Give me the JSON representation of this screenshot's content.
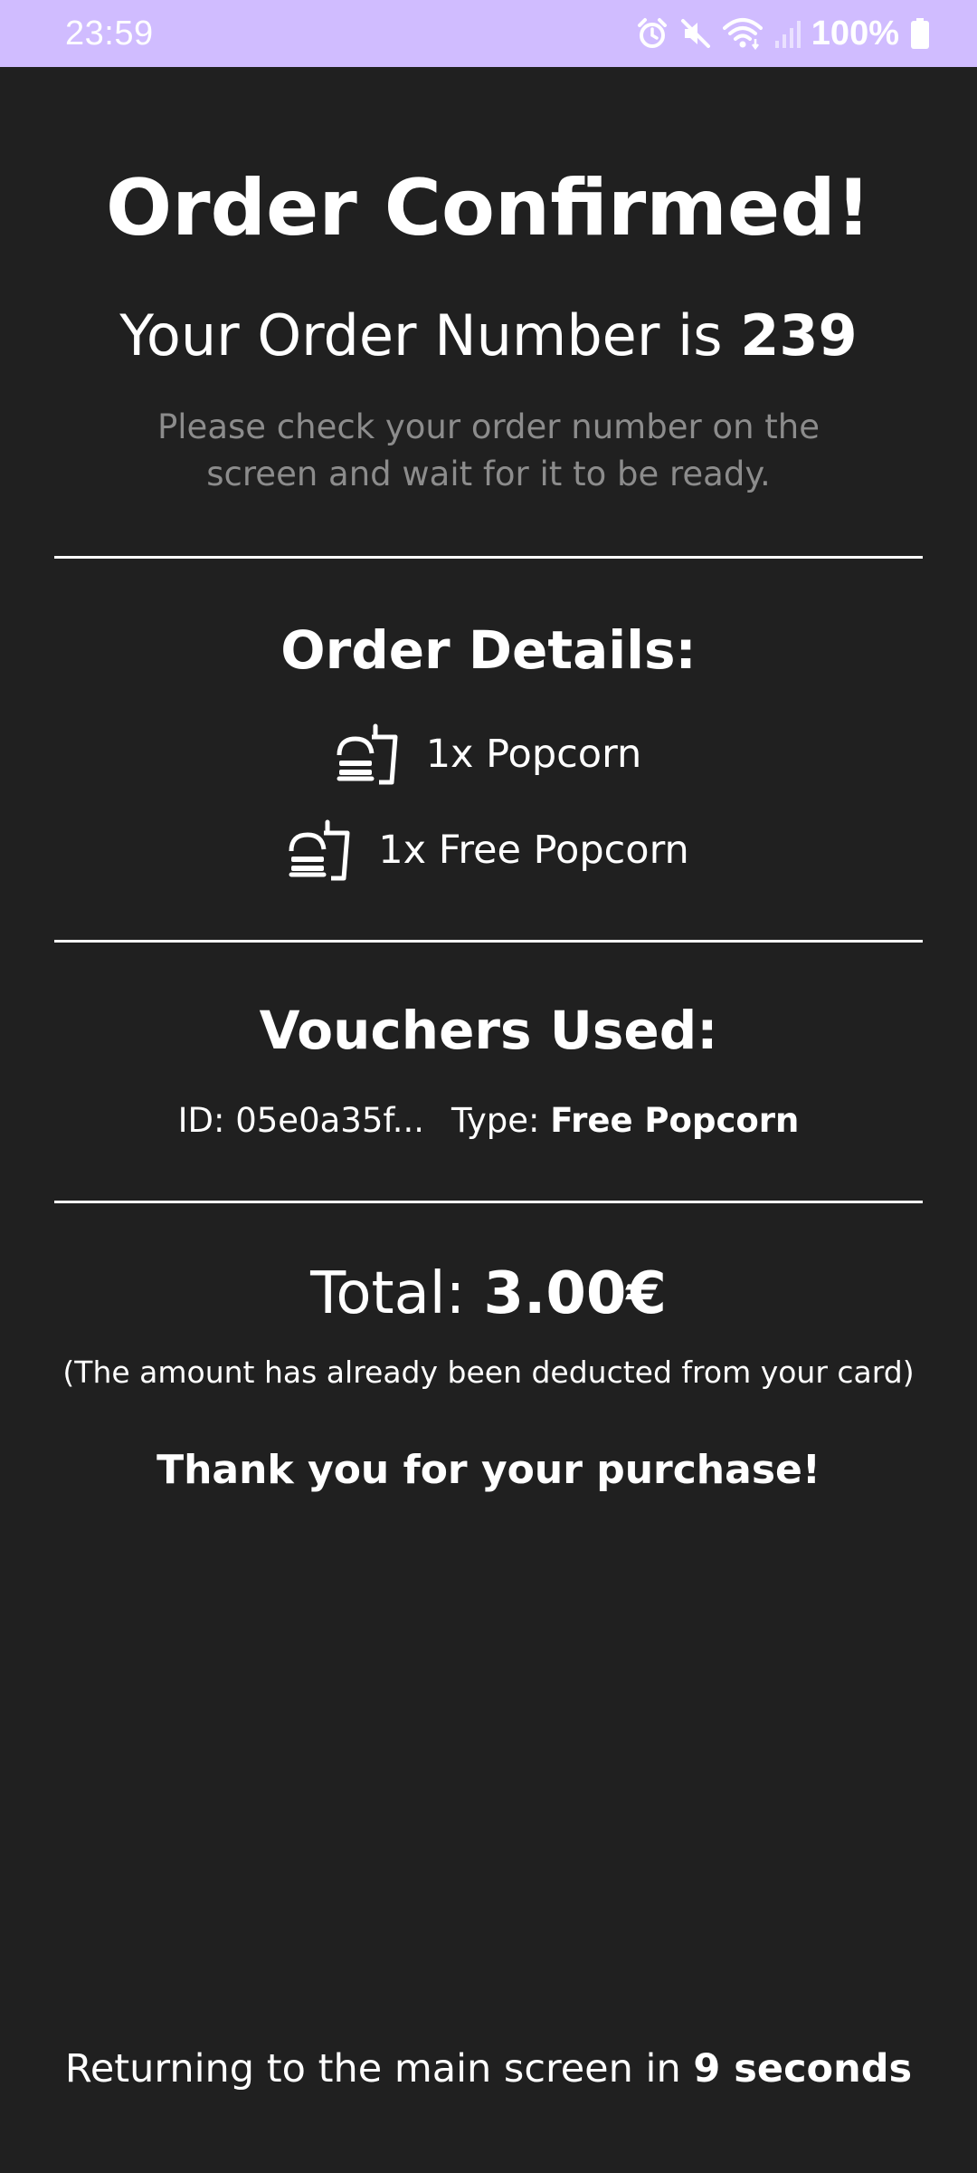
{
  "status_bar": {
    "time": "23:59",
    "battery": "100%",
    "icons": [
      "alarm-icon",
      "mute-icon",
      "wifi-icon",
      "signal-icon",
      "battery-icon"
    ]
  },
  "confirmation": {
    "title": "Order Confirmed!",
    "order_number_prefix": "Your Order Number is",
    "order_number": "239",
    "hint": "Please check your order number on the screen and wait for it to be ready."
  },
  "order_details": {
    "heading": "Order Details:",
    "items": [
      {
        "label": "1x Popcorn",
        "icon": "fast-food-icon"
      },
      {
        "label": "1x Free Popcorn",
        "icon": "fast-food-icon"
      }
    ]
  },
  "vouchers": {
    "heading": "Vouchers Used:",
    "id_label": "ID: 05e0a35f...",
    "type_prefix": "Type:",
    "type_value": "Free Popcorn"
  },
  "summary": {
    "total_prefix": "Total:",
    "total_value": "3.00€",
    "deducted_note": "(The amount has already been deducted from your card)",
    "thanks": "Thank you for your purchase!"
  },
  "footer": {
    "returning_prefix": "Returning to the main screen in",
    "returning_countdown": "9 seconds"
  },
  "colors": {
    "background": "#202020",
    "status_bar": "#d0bcff",
    "text": "#ffffff",
    "muted_text": "#8c8c8c"
  }
}
